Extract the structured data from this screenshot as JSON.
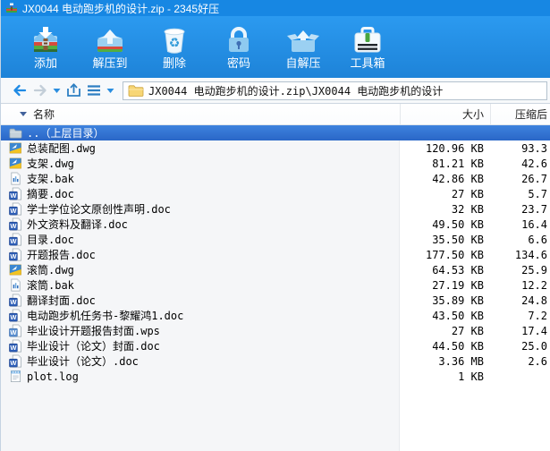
{
  "window": {
    "title": "JX0044 电动跑步机的设计.zip - 2345好压"
  },
  "toolbar": {
    "buttons": [
      {
        "id": "add",
        "label": "添加",
        "icon": "add-archive-icon"
      },
      {
        "id": "extract-to",
        "label": "解压到",
        "icon": "extract-to-icon"
      },
      {
        "id": "delete",
        "label": "删除",
        "icon": "delete-icon"
      },
      {
        "id": "password",
        "label": "密码",
        "icon": "password-lock-icon"
      },
      {
        "id": "self-extract",
        "label": "自解压",
        "icon": "self-extract-icon"
      },
      {
        "id": "toolbox",
        "label": "工具箱",
        "icon": "toolbox-icon"
      }
    ]
  },
  "address_bar": {
    "path": "JX0044 电动跑步机的设计.zip\\JX0044 电动跑步机的设计"
  },
  "file_list": {
    "columns": [
      {
        "id": "name",
        "label": "名称"
      },
      {
        "id": "size",
        "label": "大小"
      },
      {
        "id": "compressed",
        "label": "压缩后"
      }
    ],
    "rows": [
      {
        "name": "..（上层目录）",
        "icon": "folder-up",
        "size": "",
        "compressed": "",
        "selected": true
      },
      {
        "name": "总装配图.dwg",
        "icon": "dwg-file",
        "size": "120.96 KB",
        "compressed": "93.3",
        "selected": false
      },
      {
        "name": "支架.dwg",
        "icon": "dwg-file",
        "size": "81.21 KB",
        "compressed": "42.6",
        "selected": false
      },
      {
        "name": "支架.bak",
        "icon": "bak-file",
        "size": "42.86 KB",
        "compressed": "26.7",
        "selected": false
      },
      {
        "name": "摘要.doc",
        "icon": "doc-file",
        "size": "27 KB",
        "compressed": "5.7",
        "selected": false
      },
      {
        "name": "学士学位论文原创性声明.doc",
        "icon": "doc-file",
        "size": "32 KB",
        "compressed": "23.7",
        "selected": false
      },
      {
        "name": "外文资料及翻译.doc",
        "icon": "doc-file",
        "size": "49.50 KB",
        "compressed": "16.4",
        "selected": false
      },
      {
        "name": "目录.doc",
        "icon": "doc-file",
        "size": "35.50 KB",
        "compressed": "6.6",
        "selected": false
      },
      {
        "name": "开题报告.doc",
        "icon": "doc-file",
        "size": "177.50 KB",
        "compressed": "134.6",
        "selected": false
      },
      {
        "name": "滚筒.dwg",
        "icon": "dwg-file",
        "size": "64.53 KB",
        "compressed": "25.9",
        "selected": false
      },
      {
        "name": "滚筒.bak",
        "icon": "bak-file",
        "size": "27.19 KB",
        "compressed": "12.2",
        "selected": false
      },
      {
        "name": "翻译封面.doc",
        "icon": "doc-file",
        "size": "35.89 KB",
        "compressed": "24.8",
        "selected": false
      },
      {
        "name": "电动跑步机任务书-黎耀鸿1.doc",
        "icon": "doc-file",
        "size": "43.50 KB",
        "compressed": "7.2",
        "selected": false
      },
      {
        "name": "毕业设计开题报告封面.wps",
        "icon": "wps-file",
        "size": "27 KB",
        "compressed": "17.4",
        "selected": false
      },
      {
        "name": "毕业设计（论文）封面.doc",
        "icon": "doc-file",
        "size": "44.50 KB",
        "compressed": "25.0",
        "selected": false
      },
      {
        "name": "毕业设计（论文）.doc",
        "icon": "doc-file",
        "size": "3.36 MB",
        "compressed": "2.6",
        "selected": false
      },
      {
        "name": "plot.log",
        "icon": "log-file",
        "size": "1 KB",
        "compressed": "",
        "selected": false
      }
    ]
  },
  "colors": {
    "titlebar": "#1787e3",
    "toolbar_top": "#2b9af0",
    "toolbar_bottom": "#1e83d8",
    "selected_row": "#2e72d1",
    "accent_blue": "#1f8ae4",
    "name_column_shade": "#f5f6f8"
  }
}
